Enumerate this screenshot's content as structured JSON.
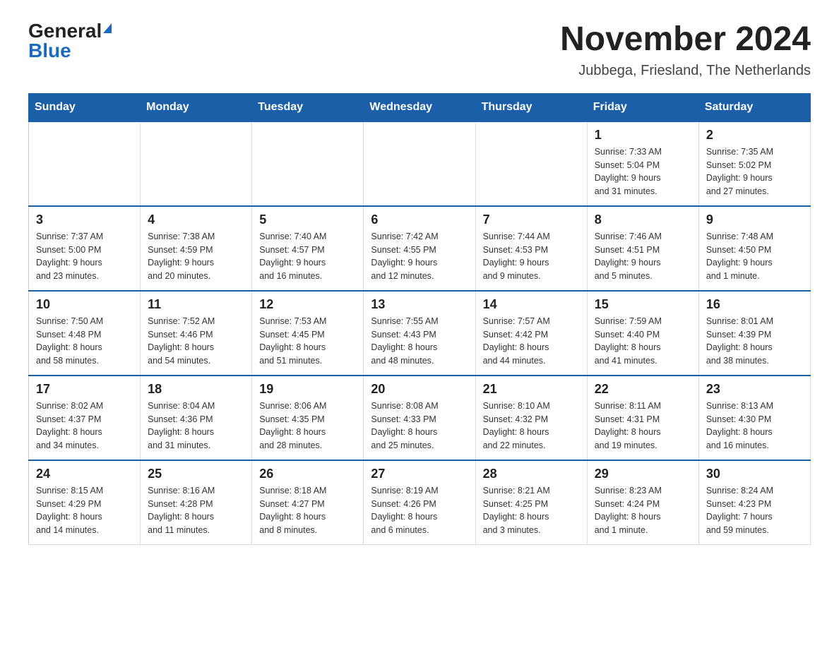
{
  "header": {
    "logo_general": "General",
    "logo_blue": "Blue",
    "title": "November 2024",
    "subtitle": "Jubbega, Friesland, The Netherlands"
  },
  "weekdays": [
    "Sunday",
    "Monday",
    "Tuesday",
    "Wednesday",
    "Thursday",
    "Friday",
    "Saturday"
  ],
  "weeks": [
    [
      {
        "day": "",
        "info": ""
      },
      {
        "day": "",
        "info": ""
      },
      {
        "day": "",
        "info": ""
      },
      {
        "day": "",
        "info": ""
      },
      {
        "day": "",
        "info": ""
      },
      {
        "day": "1",
        "info": "Sunrise: 7:33 AM\nSunset: 5:04 PM\nDaylight: 9 hours\nand 31 minutes."
      },
      {
        "day": "2",
        "info": "Sunrise: 7:35 AM\nSunset: 5:02 PM\nDaylight: 9 hours\nand 27 minutes."
      }
    ],
    [
      {
        "day": "3",
        "info": "Sunrise: 7:37 AM\nSunset: 5:00 PM\nDaylight: 9 hours\nand 23 minutes."
      },
      {
        "day": "4",
        "info": "Sunrise: 7:38 AM\nSunset: 4:59 PM\nDaylight: 9 hours\nand 20 minutes."
      },
      {
        "day": "5",
        "info": "Sunrise: 7:40 AM\nSunset: 4:57 PM\nDaylight: 9 hours\nand 16 minutes."
      },
      {
        "day": "6",
        "info": "Sunrise: 7:42 AM\nSunset: 4:55 PM\nDaylight: 9 hours\nand 12 minutes."
      },
      {
        "day": "7",
        "info": "Sunrise: 7:44 AM\nSunset: 4:53 PM\nDaylight: 9 hours\nand 9 minutes."
      },
      {
        "day": "8",
        "info": "Sunrise: 7:46 AM\nSunset: 4:51 PM\nDaylight: 9 hours\nand 5 minutes."
      },
      {
        "day": "9",
        "info": "Sunrise: 7:48 AM\nSunset: 4:50 PM\nDaylight: 9 hours\nand 1 minute."
      }
    ],
    [
      {
        "day": "10",
        "info": "Sunrise: 7:50 AM\nSunset: 4:48 PM\nDaylight: 8 hours\nand 58 minutes."
      },
      {
        "day": "11",
        "info": "Sunrise: 7:52 AM\nSunset: 4:46 PM\nDaylight: 8 hours\nand 54 minutes."
      },
      {
        "day": "12",
        "info": "Sunrise: 7:53 AM\nSunset: 4:45 PM\nDaylight: 8 hours\nand 51 minutes."
      },
      {
        "day": "13",
        "info": "Sunrise: 7:55 AM\nSunset: 4:43 PM\nDaylight: 8 hours\nand 48 minutes."
      },
      {
        "day": "14",
        "info": "Sunrise: 7:57 AM\nSunset: 4:42 PM\nDaylight: 8 hours\nand 44 minutes."
      },
      {
        "day": "15",
        "info": "Sunrise: 7:59 AM\nSunset: 4:40 PM\nDaylight: 8 hours\nand 41 minutes."
      },
      {
        "day": "16",
        "info": "Sunrise: 8:01 AM\nSunset: 4:39 PM\nDaylight: 8 hours\nand 38 minutes."
      }
    ],
    [
      {
        "day": "17",
        "info": "Sunrise: 8:02 AM\nSunset: 4:37 PM\nDaylight: 8 hours\nand 34 minutes."
      },
      {
        "day": "18",
        "info": "Sunrise: 8:04 AM\nSunset: 4:36 PM\nDaylight: 8 hours\nand 31 minutes."
      },
      {
        "day": "19",
        "info": "Sunrise: 8:06 AM\nSunset: 4:35 PM\nDaylight: 8 hours\nand 28 minutes."
      },
      {
        "day": "20",
        "info": "Sunrise: 8:08 AM\nSunset: 4:33 PM\nDaylight: 8 hours\nand 25 minutes."
      },
      {
        "day": "21",
        "info": "Sunrise: 8:10 AM\nSunset: 4:32 PM\nDaylight: 8 hours\nand 22 minutes."
      },
      {
        "day": "22",
        "info": "Sunrise: 8:11 AM\nSunset: 4:31 PM\nDaylight: 8 hours\nand 19 minutes."
      },
      {
        "day": "23",
        "info": "Sunrise: 8:13 AM\nSunset: 4:30 PM\nDaylight: 8 hours\nand 16 minutes."
      }
    ],
    [
      {
        "day": "24",
        "info": "Sunrise: 8:15 AM\nSunset: 4:29 PM\nDaylight: 8 hours\nand 14 minutes."
      },
      {
        "day": "25",
        "info": "Sunrise: 8:16 AM\nSunset: 4:28 PM\nDaylight: 8 hours\nand 11 minutes."
      },
      {
        "day": "26",
        "info": "Sunrise: 8:18 AM\nSunset: 4:27 PM\nDaylight: 8 hours\nand 8 minutes."
      },
      {
        "day": "27",
        "info": "Sunrise: 8:19 AM\nSunset: 4:26 PM\nDaylight: 8 hours\nand 6 minutes."
      },
      {
        "day": "28",
        "info": "Sunrise: 8:21 AM\nSunset: 4:25 PM\nDaylight: 8 hours\nand 3 minutes."
      },
      {
        "day": "29",
        "info": "Sunrise: 8:23 AM\nSunset: 4:24 PM\nDaylight: 8 hours\nand 1 minute."
      },
      {
        "day": "30",
        "info": "Sunrise: 8:24 AM\nSunset: 4:23 PM\nDaylight: 7 hours\nand 59 minutes."
      }
    ]
  ]
}
